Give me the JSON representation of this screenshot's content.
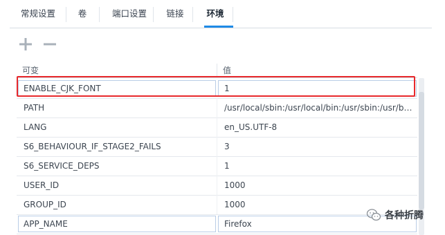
{
  "tabs": [
    {
      "label": "常规设置",
      "active": false
    },
    {
      "label": "卷",
      "active": false
    },
    {
      "label": "端口设置",
      "active": false
    },
    {
      "label": "链接",
      "active": false
    },
    {
      "label": "环境",
      "active": true
    }
  ],
  "toolbar": {
    "add_icon": "plus-icon",
    "remove_icon": "minus-icon"
  },
  "table": {
    "columns": [
      "可变",
      "值"
    ],
    "rows": [
      {
        "name": "ENABLE_CJK_FONT",
        "value": "1"
      },
      {
        "name": "PATH",
        "value": "/usr/local/sbin:/usr/local/bin:/usr/sbin:/usr/bin:/sbin:/bin"
      },
      {
        "name": "LANG",
        "value": "en_US.UTF-8"
      },
      {
        "name": "S6_BEHAVIOUR_IF_STAGE2_FAILS",
        "value": "3"
      },
      {
        "name": "S6_SERVICE_DEPS",
        "value": "1"
      },
      {
        "name": "USER_ID",
        "value": "1000"
      },
      {
        "name": "GROUP_ID",
        "value": "1000"
      },
      {
        "name": "APP_NAME",
        "value": "Firefox"
      }
    ]
  },
  "watermark": {
    "text": "各种折腾",
    "icon": "wechat-icon"
  },
  "colors": {
    "accent": "#1e8ae6",
    "highlight": "#e8282b"
  }
}
